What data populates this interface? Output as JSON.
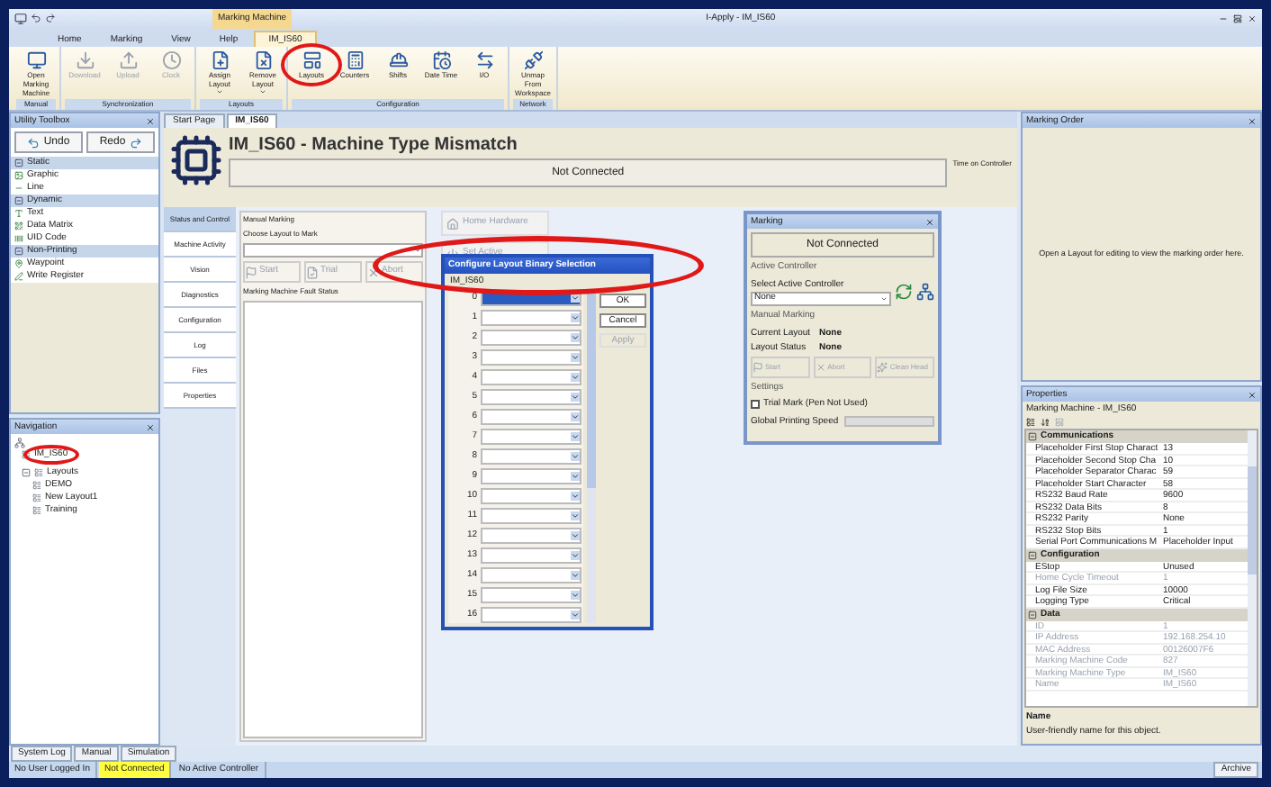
{
  "title_bar": {
    "context_group": "Marking Machine",
    "title": "I-Apply - IM_IS60"
  },
  "ribbon": {
    "tabs": [
      {
        "label": "Home",
        "selected": false
      },
      {
        "label": "Marking",
        "selected": false
      },
      {
        "label": "View",
        "selected": false
      },
      {
        "label": "Help",
        "selected": false
      },
      {
        "label": "IM_IS60",
        "selected": true
      }
    ],
    "groups": [
      {
        "label": "Manual",
        "buttons": [
          {
            "label": "Open Marking Machine",
            "disabled": false,
            "dropdown": false,
            "highlighted": false
          }
        ]
      },
      {
        "label": "Synchronization",
        "buttons": [
          {
            "label": "Download",
            "disabled": true,
            "dropdown": false,
            "highlighted": false
          },
          {
            "label": "Upload",
            "disabled": true,
            "dropdown": false,
            "highlighted": false
          },
          {
            "label": "Clock",
            "disabled": true,
            "dropdown": false,
            "highlighted": false
          }
        ]
      },
      {
        "label": "Layouts",
        "buttons": [
          {
            "label": "Assign Layout",
            "disabled": false,
            "dropdown": true,
            "highlighted": false
          },
          {
            "label": "Remove Layout",
            "disabled": false,
            "dropdown": true,
            "highlighted": false
          }
        ]
      },
      {
        "label": "Configuration",
        "buttons": [
          {
            "label": "Layouts",
            "disabled": false,
            "dropdown": false,
            "highlighted": true
          },
          {
            "label": "Counters",
            "disabled": false,
            "dropdown": false,
            "highlighted": false
          },
          {
            "label": "Shifts",
            "disabled": false,
            "dropdown": false,
            "highlighted": false
          },
          {
            "label": "Date Time",
            "disabled": false,
            "dropdown": false,
            "highlighted": false
          },
          {
            "label": "I/O",
            "disabled": false,
            "dropdown": false,
            "highlighted": false
          }
        ]
      },
      {
        "label": "Network",
        "buttons": [
          {
            "label": "Unmap From Workspace",
            "disabled": false,
            "dropdown": false,
            "highlighted": false
          }
        ]
      }
    ]
  },
  "toolbox": {
    "title": "Utility Toolbox",
    "undo": "Undo",
    "redo": "Redo",
    "sections": [
      {
        "label": "Static",
        "expanded": true,
        "items": [
          "Graphic",
          "Line"
        ]
      },
      {
        "label": "Dynamic",
        "expanded": true,
        "items": [
          "Text",
          "Data Matrix",
          "UID Code"
        ]
      },
      {
        "label": "Non-Printing",
        "expanded": true,
        "items": [
          "Waypoint",
          "Write Register"
        ]
      }
    ]
  },
  "navigation": {
    "title": "Navigation",
    "tree": [
      {
        "label": "IM_IS60",
        "highlighted": true
      },
      {
        "label": "Layouts",
        "highlighted": false,
        "expanded": true,
        "children": [
          {
            "label": "DEMO",
            "highlighted": false
          },
          {
            "label": "New Layout1",
            "highlighted": false
          },
          {
            "label": "Training",
            "highlighted": false
          }
        ]
      }
    ]
  },
  "document_tabs": [
    {
      "label": "Start Page",
      "selected": false
    },
    {
      "label": "IM_IS60",
      "selected": true
    }
  ],
  "machine": {
    "title": "IM_IS60 - Machine Type Mismatch",
    "connection": "Not Connected",
    "time_label": "Time on Controller"
  },
  "side_nav": [
    {
      "label": "Status and Control",
      "selected": true
    },
    {
      "label": "Machine Activity",
      "selected": false
    },
    {
      "label": "Vision",
      "selected": false
    },
    {
      "label": "Diagnostics",
      "selected": false
    },
    {
      "label": "Configuration",
      "selected": false
    },
    {
      "label": "Log",
      "selected": false
    },
    {
      "label": "Files",
      "selected": false
    },
    {
      "label": "Properties",
      "selected": false
    }
  ],
  "manual_marking": {
    "title": "Manual Marking",
    "choose_label": "Choose Layout to Mark",
    "buttons": [
      {
        "label": "Start",
        "disabled": true
      },
      {
        "label": "Trial",
        "disabled": true
      },
      {
        "label": "Abort",
        "disabled": true
      }
    ],
    "fault_title": "Marking Machine Fault Status"
  },
  "hardware_buttons": [
    {
      "label": "Home Hardware",
      "disabled": true
    },
    {
      "label": "Set Active",
      "disabled": true
    }
  ],
  "marking_panel": {
    "title": "Marking",
    "connection": "Not Connected",
    "active_controller_title": "Active Controller",
    "select_label": "Select Active Controller",
    "select_value": "None",
    "manual_title": "Manual Marking",
    "fields": [
      {
        "label": "Current Layout",
        "value": "None"
      },
      {
        "label": "Layout Status",
        "value": "None"
      }
    ],
    "buttons": [
      {
        "label": "Start",
        "disabled": true
      },
      {
        "label": "Abort",
        "disabled": true
      },
      {
        "label": "Clean Head",
        "disabled": true
      }
    ],
    "settings_title": "Settings",
    "trial_mark": {
      "label": "Trial Mark (Pen Not Used)",
      "checked": false
    },
    "speed_label": "Global Printing Speed"
  },
  "dialog": {
    "title": "Configure Layout Binary Selection",
    "machine": "IM_IS60",
    "highlighted": true,
    "rows": [
      {
        "label": "0",
        "selected": true
      },
      {
        "label": "1",
        "selected": false
      },
      {
        "label": "2",
        "selected": false
      },
      {
        "label": "3",
        "selected": false
      },
      {
        "label": "4",
        "selected": false
      },
      {
        "label": "5",
        "selected": false
      },
      {
        "label": "6",
        "selected": false
      },
      {
        "label": "7",
        "selected": false
      },
      {
        "label": "8",
        "selected": false
      },
      {
        "label": "9",
        "selected": false
      },
      {
        "label": "10",
        "selected": false
      },
      {
        "label": "11",
        "selected": false
      },
      {
        "label": "12",
        "selected": false
      },
      {
        "label": "13",
        "selected": false
      },
      {
        "label": "14",
        "selected": false
      },
      {
        "label": "15",
        "selected": false
      },
      {
        "label": "16",
        "selected": false
      }
    ],
    "buttons": [
      {
        "label": "OK",
        "disabled": false
      },
      {
        "label": "Cancel",
        "disabled": false
      },
      {
        "label": "Apply",
        "disabled": true
      }
    ]
  },
  "marking_order": {
    "title": "Marking Order",
    "message": "Open a Layout for editing to view the marking order here."
  },
  "properties": {
    "title": "Properties",
    "object": "Marking Machine - IM_IS60",
    "categories": [
      {
        "label": "Communications",
        "expanded": true,
        "rows": [
          {
            "name": "Placeholder First Stop Charact",
            "value": "13",
            "disabled": false
          },
          {
            "name": "Placeholder Second Stop Cha",
            "value": "10",
            "disabled": false
          },
          {
            "name": "Placeholder Separator Charac",
            "value": "59",
            "disabled": false
          },
          {
            "name": "Placeholder Start Character",
            "value": "58",
            "disabled": false
          },
          {
            "name": "RS232 Baud Rate",
            "value": "9600",
            "disabled": false
          },
          {
            "name": "RS232 Data Bits",
            "value": "8",
            "disabled": false
          },
          {
            "name": "RS232 Parity",
            "value": "None",
            "disabled": false
          },
          {
            "name": "RS232 Stop Bits",
            "value": "1",
            "disabled": false
          },
          {
            "name": "Serial Port Communications M",
            "value": "Placeholder Input",
            "disabled": false
          }
        ]
      },
      {
        "label": "Configuration",
        "expanded": true,
        "rows": [
          {
            "name": "EStop",
            "value": "Unused",
            "disabled": false
          },
          {
            "name": "Home Cycle Timeout",
            "value": "1",
            "disabled": true
          },
          {
            "name": "Log File Size",
            "value": "10000",
            "disabled": false
          },
          {
            "name": "Logging Type",
            "value": "Critical",
            "disabled": false
          }
        ]
      },
      {
        "label": "Data",
        "expanded": true,
        "rows": [
          {
            "name": "ID",
            "value": "1",
            "disabled": true
          },
          {
            "name": "IP Address",
            "value": "192.168.254.10",
            "disabled": true
          },
          {
            "name": "MAC Address",
            "value": "00126007F6",
            "disabled": true
          },
          {
            "name": "Marking Machine Code",
            "value": "827",
            "disabled": true
          },
          {
            "name": "Marking Machine Type",
            "value": "IM_IS60",
            "disabled": true
          },
          {
            "name": "Name",
            "value": "IM_IS60",
            "disabled": true
          }
        ]
      }
    ],
    "description_title": "Name",
    "description": "User-friendly name for this object."
  },
  "bottom_tabs": [
    {
      "label": "System Log",
      "selected": false
    },
    {
      "label": "Manual",
      "selected": false
    },
    {
      "label": "Simulation",
      "selected": false
    }
  ],
  "status_bar": {
    "items": [
      {
        "label": "No User Logged In",
        "warning": false
      },
      {
        "label": "Not Connected",
        "warning": true
      },
      {
        "label": "No Active Controller",
        "warning": false
      }
    ],
    "right": "Archive"
  }
}
